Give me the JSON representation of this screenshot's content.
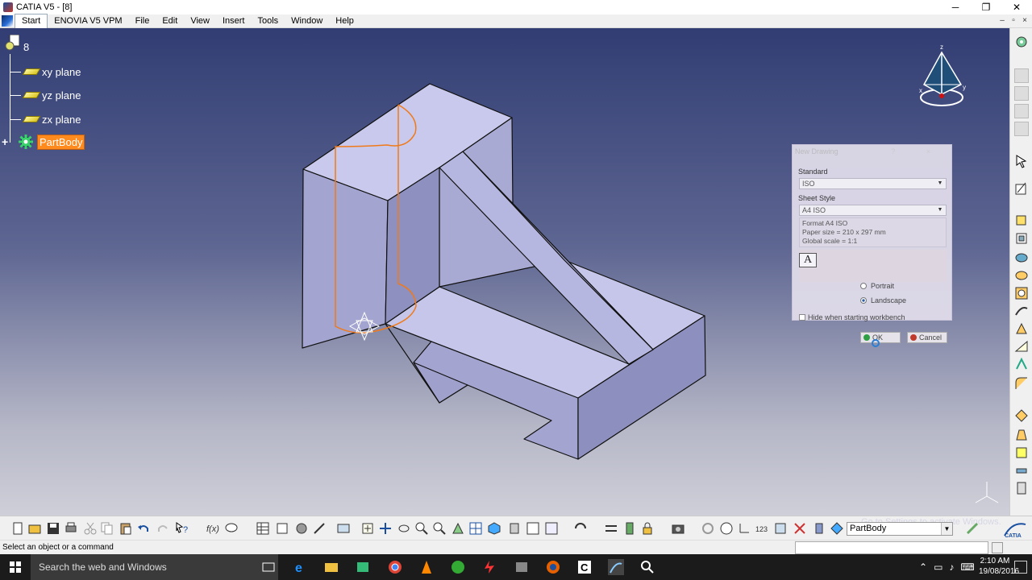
{
  "window": {
    "title": "CATIA V5 - [8]",
    "minimize": "─",
    "maximize": "❐",
    "close": "✕"
  },
  "menu": {
    "items": [
      "Start",
      "ENOVIA V5 VPM",
      "File",
      "Edit",
      "View",
      "Insert",
      "Tools",
      "Window",
      "Help"
    ],
    "mdi": [
      "–",
      "▫",
      "×"
    ]
  },
  "tree": {
    "root": "8",
    "planes": [
      "xy plane",
      "yz plane",
      "zx plane"
    ],
    "partbody": "PartBody",
    "expander": "+"
  },
  "compass": {
    "x": "x",
    "y": "y",
    "z": "z"
  },
  "dialog": {
    "title": "New Drawing",
    "title_controls": "? ×",
    "standard_label": "Standard",
    "standard_value": "ISO",
    "sheet_style_label": "Sheet Style",
    "sheet_style_value": "A4 ISO",
    "info_lines": [
      "Format A4 ISO",
      "Paper size = 210 x 297 mm",
      "Global scale = 1:1"
    ],
    "a_icon": "A",
    "portrait": "Portrait",
    "landscape": "Landscape",
    "hide_check": "Hide when starting workbench",
    "ok": "OK",
    "cancel": "Cancel"
  },
  "bottom": {
    "combo_value": "PartBody",
    "watermark": "Go to Settings to activate Windows."
  },
  "status": {
    "message": "Select an object or a command"
  },
  "taskbar": {
    "search_placeholder": "Search the web and Windows",
    "time": "2:10 AM",
    "date": "19/08/2016"
  },
  "colors": {
    "viewport_top": "#313d73",
    "viewport_bottom": "#cfcfd9",
    "part_face": "#b7b8e0",
    "sketch_orange": "#f07a1a",
    "partbody_highlight": "#ff8a1e"
  }
}
